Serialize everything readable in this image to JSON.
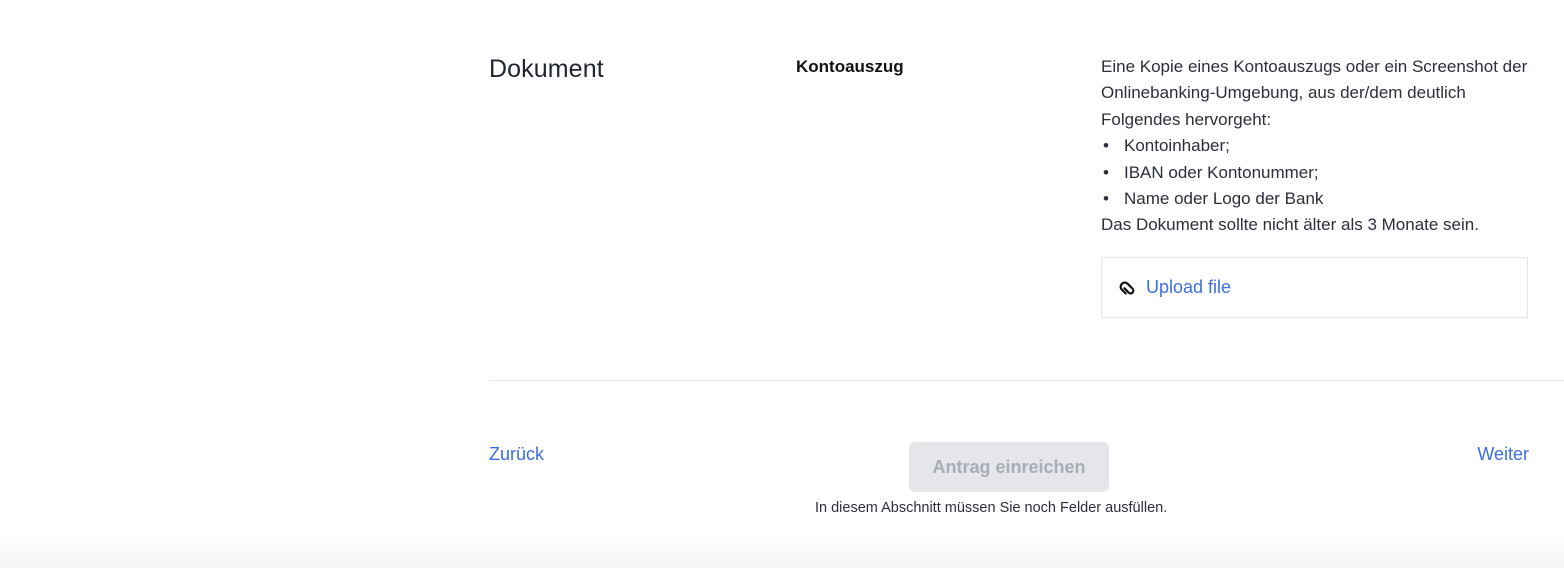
{
  "section": {
    "title": "Dokument",
    "document_type": "Kontoauszug"
  },
  "description": {
    "intro": "Eine Kopie eines Kontoauszugs oder ein Screenshot der Onlinebanking-Umgebung, aus der/dem deutlich Folgendes hervorgeht:",
    "bullet_symbol": "•",
    "items": [
      "Kontoinhaber;",
      "IBAN oder Kontonummer;",
      "Name oder Logo der Bank"
    ],
    "note": "Das Dokument sollte nicht älter als 3 Monate sein."
  },
  "upload": {
    "icon": "paperclip-icon",
    "label": "Upload file"
  },
  "navigation": {
    "back_label": "Zurück",
    "next_label": "Weiter",
    "submit_label": "Antrag einreichen",
    "submit_disabled": true,
    "hint": "In diesem Abschnitt müssen Sie noch Felder ausfüllen."
  },
  "colors": {
    "link": "#3b6fe0",
    "button_disabled_bg": "#e4e6ea",
    "button_disabled_text": "#a9adb6",
    "divider": "#e6e8ec"
  }
}
